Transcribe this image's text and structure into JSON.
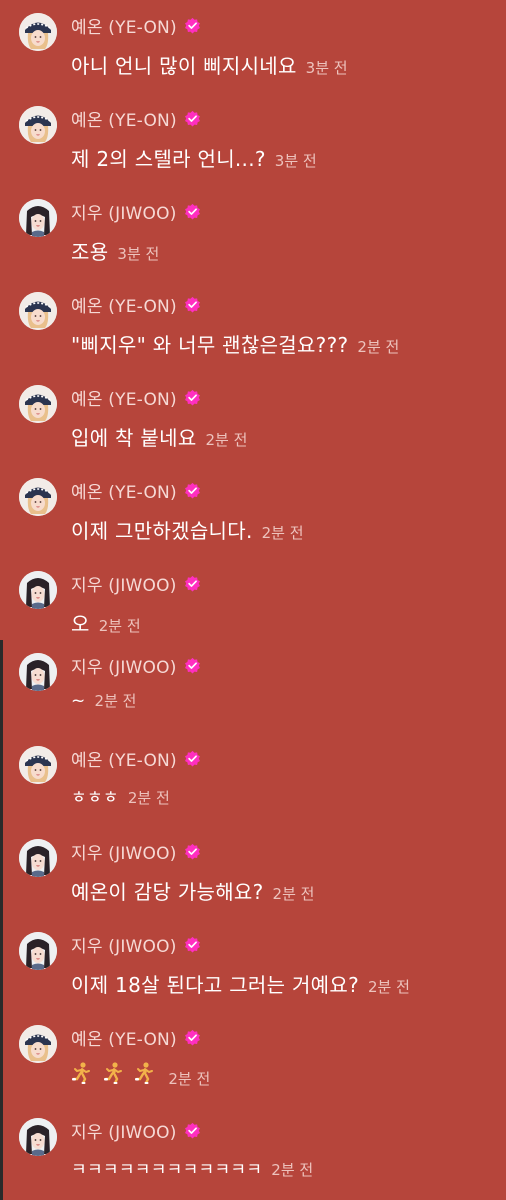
{
  "colors": {
    "background": "#b6453b",
    "name_text": "#f6d9d5",
    "message_text": "#ffffff",
    "time_text": "#edc3bd",
    "verified_badge": "#ff2fc0"
  },
  "messages": [
    {
      "author": "예온 (YE-ON)",
      "avatar": "yeon",
      "text": "아니 언니 많이 삐지시네요",
      "time": "3분 전"
    },
    {
      "author": "예온 (YE-ON)",
      "avatar": "yeon",
      "text": "제 2의 스텔라 언니...?",
      "time": "3분 전"
    },
    {
      "author": "지우 (JIWOO)",
      "avatar": "jiwoo",
      "text": "조용",
      "time": "3분 전"
    },
    {
      "author": "예온 (YE-ON)",
      "avatar": "yeon",
      "text": "\"삐지우\" 와 너무 괜찮은걸요???",
      "time": "2분 전"
    },
    {
      "author": "예온 (YE-ON)",
      "avatar": "yeon",
      "text": "입에 착 붙네요",
      "time": "2분 전"
    },
    {
      "author": "예온 (YE-ON)",
      "avatar": "yeon",
      "text": "이제 그만하겠습니다.",
      "time": "2분 전"
    },
    {
      "author": "지우 (JIWOO)",
      "avatar": "jiwoo",
      "text": "오",
      "time": "2분 전"
    },
    {
      "author": "지우 (JIWOO)",
      "avatar": "jiwoo",
      "text": "~",
      "time": "2분 전"
    },
    {
      "author": "예온 (YE-ON)",
      "avatar": "yeon",
      "text": "ㅎㅎㅎ",
      "time": "2분 전"
    },
    {
      "author": "지우 (JIWOO)",
      "avatar": "jiwoo",
      "text": "예온이 감당 가능해요?",
      "time": "2분 전"
    },
    {
      "author": "지우 (JIWOO)",
      "avatar": "jiwoo",
      "text": "이제 18살 된다고 그러는 거예요?",
      "time": "2분 전"
    },
    {
      "author": "예온 (YE-ON)",
      "avatar": "yeon",
      "text": "",
      "emoji": "runner-emoji",
      "emoji_count": 3,
      "time": "2분 전"
    },
    {
      "author": "지우 (JIWOO)",
      "avatar": "jiwoo",
      "text": "ㅋㅋㅋㅋㅋㅋㅋㅋㅋㅋㅋㅋ",
      "time": "2분 전"
    }
  ]
}
